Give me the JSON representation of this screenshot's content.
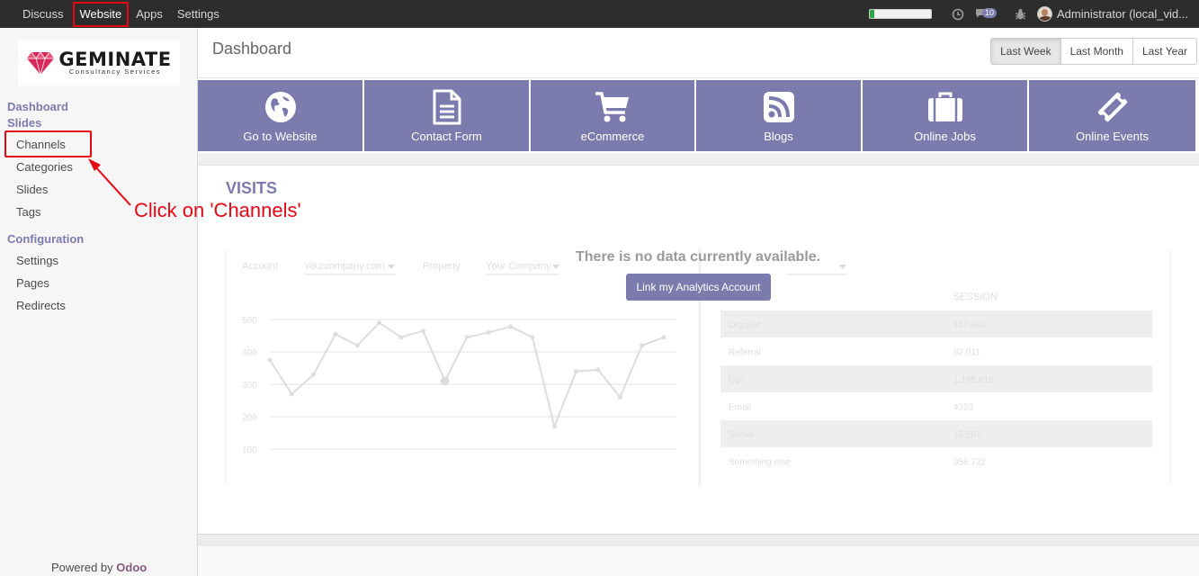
{
  "topbar": {
    "menu": [
      "Discuss",
      "Website",
      "Apps",
      "Settings"
    ],
    "progress_fraction": 0.08,
    "messages_badge": "10",
    "user_name": "Administrator (local_vid..."
  },
  "sidebar": {
    "logo": {
      "brand": "GEMINATE",
      "tagline": "Consultancy Services"
    },
    "sections": [
      {
        "title": "Dashboard",
        "items": []
      },
      {
        "title": "Slides",
        "items": [
          "Channels",
          "Categories",
          "Slides",
          "Tags"
        ]
      },
      {
        "title": "Configuration",
        "items": [
          "Settings",
          "Pages",
          "Redirects"
        ]
      }
    ],
    "powered_prefix": "Powered by",
    "powered_brand": "Odoo"
  },
  "annotation": {
    "text": "Click on 'Channels'"
  },
  "main": {
    "title": "Dashboard",
    "period_buttons": [
      {
        "label": "Last Week",
        "active": true
      },
      {
        "label": "Last Month",
        "active": false
      },
      {
        "label": "Last Year",
        "active": false
      }
    ],
    "tiles": [
      {
        "label": "Go to Website",
        "icon": "globe-icon"
      },
      {
        "label": "Contact Form",
        "icon": "document-icon"
      },
      {
        "label": "eCommerce",
        "icon": "cart-icon"
      },
      {
        "label": "Blogs",
        "icon": "rss-icon"
      },
      {
        "label": "Online Jobs",
        "icon": "briefcase-icon"
      },
      {
        "label": "Online Events",
        "icon": "ticket-icon"
      }
    ],
    "visits": {
      "title": "VISITS",
      "no_data_message": "There is no data currently available.",
      "link_button": "Link my Analytics Account"
    },
    "placeholder": {
      "account_label": "Account",
      "account_value": "Yourcompany.com",
      "property_label": "Property",
      "property_value": "Your Company",
      "session_header": "SESSION",
      "rows": [
        {
          "label": "Organic",
          "value": "117,348"
        },
        {
          "label": "Referral",
          "value": "82,011"
        },
        {
          "label": "Cpc",
          "value": "1,185,618"
        },
        {
          "label": "Email",
          "value": "4223"
        },
        {
          "label": "Social",
          "value": "15,567"
        },
        {
          "label": "Something else",
          "value": "956,732"
        }
      ],
      "chart_data": {
        "type": "line",
        "y_ticks": [
          "500",
          "400",
          "300",
          "200",
          "100"
        ],
        "ylim": [
          100,
          500
        ],
        "values": [
          375,
          270,
          330,
          455,
          420,
          490,
          445,
          465,
          310,
          445,
          460,
          478,
          445,
          170,
          340,
          345,
          260,
          420,
          445
        ]
      }
    }
  },
  "colors": {
    "accent": "#7c7bad",
    "topbar": "#2d2d2d",
    "highlight_red": "#e30613"
  }
}
